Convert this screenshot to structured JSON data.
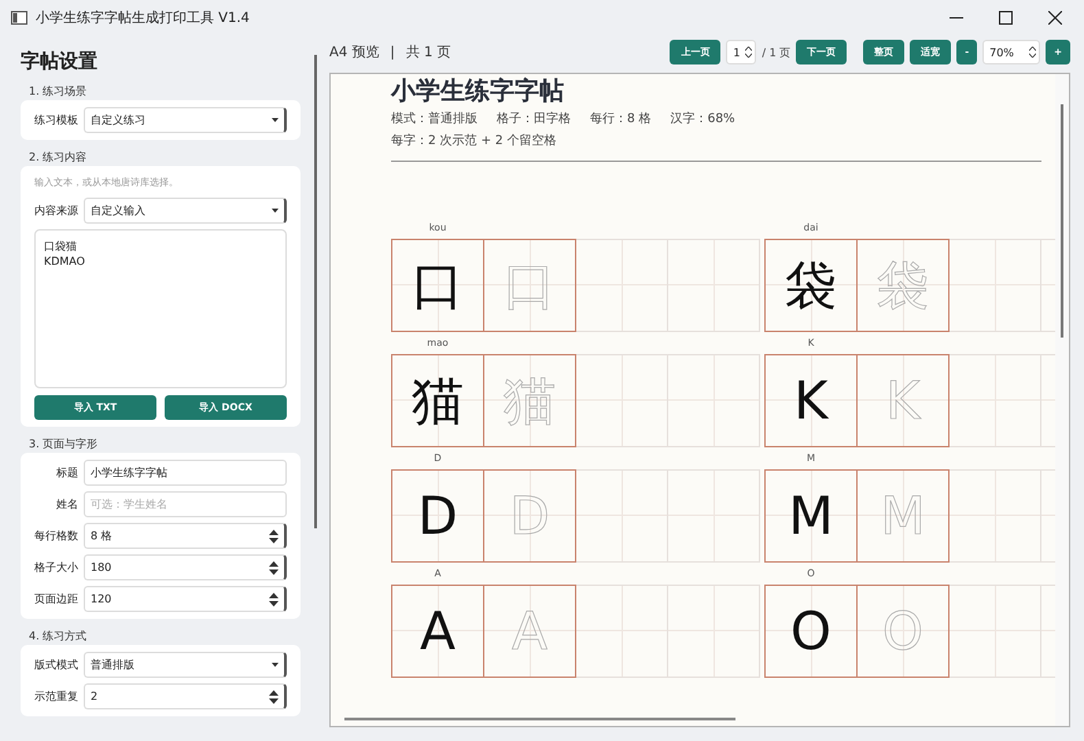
{
  "window": {
    "title": "小学生练字字帖生成打印工具 V1.4"
  },
  "sidebar": {
    "heading": "字帖设置",
    "sections": [
      {
        "title": "1. 练习场景",
        "items": [
          {
            "kind": "select",
            "label": "练习模板",
            "value": "自定义练习"
          }
        ]
      },
      {
        "title": "2. 练习内容",
        "items": [
          {
            "kind": "note",
            "text": "输入文本，或从本地唐诗库选择。"
          },
          {
            "kind": "select",
            "label": "内容来源",
            "value": "自定义输入"
          },
          {
            "kind": "textarea",
            "lines": [
              "口袋猫",
              "KDMAO"
            ]
          },
          {
            "kind": "buttons",
            "buttons": [
              "导入 TXT",
              "导入 DOCX"
            ]
          }
        ]
      },
      {
        "title": "3. 页面与字形",
        "items": [
          {
            "kind": "input",
            "label": "标题",
            "value": "小学生练字字帖"
          },
          {
            "kind": "input",
            "label": "姓名",
            "placeholder": "可选：学生姓名"
          },
          {
            "kind": "spin",
            "label": "每行格数",
            "value": "8 格"
          },
          {
            "kind": "spin",
            "label": "格子大小",
            "value": "180"
          },
          {
            "kind": "spin",
            "label": "页面边距",
            "value": "120"
          }
        ]
      },
      {
        "title": "4. 练习方式",
        "items": [
          {
            "kind": "select",
            "label": "版式模式",
            "value": "普通排版"
          },
          {
            "kind": "spin",
            "label": "示范重复",
            "value": "2"
          }
        ]
      }
    ]
  },
  "toolbar": {
    "preview_label": "A4 预览",
    "separator": "|",
    "page_count": "共 1 页",
    "prev_button": "上一页",
    "page_input": "1",
    "page_total": "/ 1 页",
    "next_button": "下一页",
    "fit_page_button": "整页",
    "fit_width_button": "适宽",
    "zoom_out_button": "-",
    "zoom_value": "70%",
    "zoom_in_button": "+"
  },
  "preview": {
    "title": "小学生练字字帖",
    "meta": [
      "模式：普通排版",
      "格子：田字格",
      "每行：8 格",
      "汉字：68%"
    ],
    "summary": "每字：2 次示范 + 2 个留空格",
    "entries": [
      {
        "pinyin": "kou",
        "cells": [
          {
            "kind": "model",
            "char": "口"
          },
          {
            "kind": "trace",
            "char": "口"
          },
          {
            "kind": "blank"
          },
          {
            "kind": "blank"
          }
        ]
      },
      {
        "pinyin": "dai",
        "cells": [
          {
            "kind": "model",
            "char": "袋"
          },
          {
            "kind": "trace",
            "char": "袋"
          },
          {
            "kind": "blank"
          },
          {
            "kind": "blank"
          }
        ]
      },
      {
        "pinyin": "mao",
        "cells": [
          {
            "kind": "model",
            "char": "猫"
          },
          {
            "kind": "trace",
            "char": "猫"
          },
          {
            "kind": "blank"
          },
          {
            "kind": "blank"
          }
        ]
      },
      {
        "pinyin": "K",
        "cells": [
          {
            "kind": "model",
            "char": "K"
          },
          {
            "kind": "trace",
            "char": "K"
          },
          {
            "kind": "blank"
          },
          {
            "kind": "blank"
          }
        ]
      },
      {
        "pinyin": "D",
        "cells": [
          {
            "kind": "model",
            "char": "D"
          },
          {
            "kind": "trace",
            "char": "D"
          },
          {
            "kind": "blank"
          },
          {
            "kind": "blank"
          }
        ]
      },
      {
        "pinyin": "M",
        "cells": [
          {
            "kind": "model",
            "char": "M"
          },
          {
            "kind": "trace",
            "char": "M"
          },
          {
            "kind": "blank"
          },
          {
            "kind": "blank"
          }
        ]
      },
      {
        "pinyin": "A",
        "cells": [
          {
            "kind": "model",
            "char": "A"
          },
          {
            "kind": "trace",
            "char": "A"
          },
          {
            "kind": "blank"
          },
          {
            "kind": "blank"
          }
        ]
      },
      {
        "pinyin": "O",
        "cells": [
          {
            "kind": "model",
            "char": "O"
          },
          {
            "kind": "trace",
            "char": "O"
          },
          {
            "kind": "blank"
          },
          {
            "kind": "blank"
          }
        ]
      }
    ]
  }
}
